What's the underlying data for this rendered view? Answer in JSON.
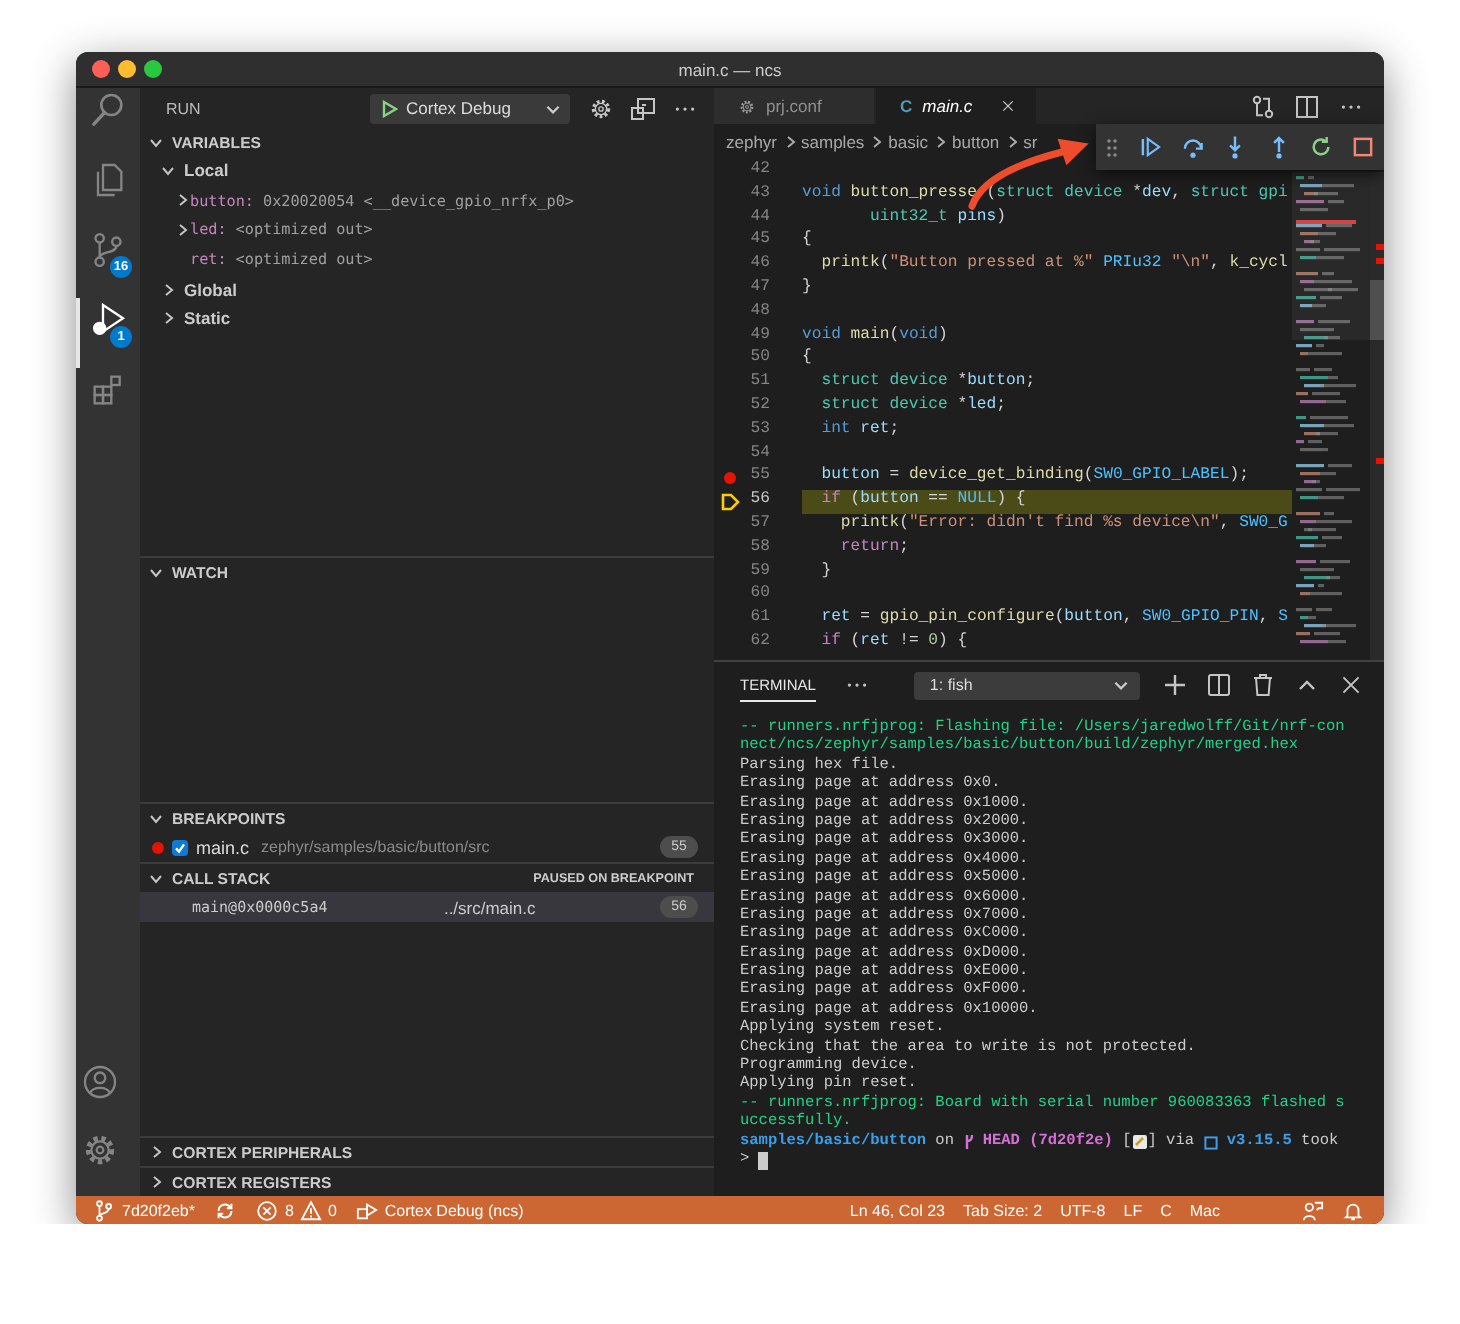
{
  "window": {
    "title": "main.c — ncs"
  },
  "activity_bar": {
    "items": [
      {
        "kind": "search",
        "selected": false
      },
      {
        "kind": "files",
        "selected": false
      },
      {
        "kind": "source-control",
        "badge": "16",
        "selected": false
      },
      {
        "kind": "debug",
        "badge": "1",
        "selected": true
      },
      {
        "kind": "extensions",
        "selected": false
      }
    ],
    "bottom_items": [
      {
        "kind": "account"
      },
      {
        "kind": "settings"
      }
    ]
  },
  "sidebar": {
    "title": "RUN",
    "launch_config": "Cortex Debug",
    "sections": [
      {
        "kind": "variables",
        "title": "VARIABLES",
        "expanded": true,
        "scopes": [
          {
            "name": "Local",
            "expanded": true,
            "children": [
              {
                "name": "button:",
                "value": "0x20020054 <__device_gpio_nrfx_p0>",
                "expanded": false
              },
              {
                "name": "led:",
                "value": "<optimized out>",
                "expanded": false
              },
              {
                "name": "ret:",
                "value": "<optimized out>"
              }
            ]
          },
          {
            "name": "Global",
            "expanded": false
          },
          {
            "name": "Static",
            "expanded": false
          }
        ]
      },
      {
        "kind": "watch",
        "title": "WATCH",
        "expanded": true
      },
      {
        "kind": "breakpoints",
        "title": "BREAKPOINTS",
        "expanded": true,
        "items": [
          {
            "file": "main.c",
            "path": "zephyr/samples/basic/button/src",
            "line": "55",
            "checked": true
          }
        ]
      },
      {
        "kind": "call_stack",
        "title": "CALL STACK",
        "status": "PAUSED ON BREAKPOINT",
        "expanded": true,
        "frames": [
          {
            "name": "main@0x0000c5a4",
            "file": "../src/main.c",
            "line": "56",
            "selected": true
          }
        ]
      },
      {
        "kind": "custom",
        "title": "CORTEX PERIPHERALS",
        "expanded": false
      },
      {
        "kind": "custom",
        "title": "CORTEX REGISTERS",
        "expanded": false
      }
    ]
  },
  "editor": {
    "tabs": [
      {
        "label": "prj.conf",
        "selected": false,
        "preview": false
      },
      {
        "label": "main.c",
        "icon_text": "C",
        "selected": true,
        "preview": true
      }
    ],
    "breadcrumbs": [
      "zephyr",
      "samples",
      "basic",
      "button",
      "sr"
    ],
    "debug_toolbar": [
      {
        "kind": "continue"
      },
      {
        "kind": "step-over"
      },
      {
        "kind": "step-into"
      },
      {
        "kind": "step-out"
      },
      {
        "kind": "restart"
      },
      {
        "kind": "stop"
      }
    ],
    "lines": [
      {
        "number": "42",
        "breakpoint": false,
        "current": false
      },
      {
        "number": "43",
        "breakpoint": false,
        "current": false,
        "tokens": [
          {
            "kind": "kw",
            "text": "void"
          },
          {
            "kind": "fn",
            "text": " button_presse",
            "obscured": true
          },
          {
            "kind": "p",
            "text": "("
          },
          {
            "kind": "type",
            "text": "struct device"
          },
          {
            "kind": "p",
            "text": " *"
          },
          {
            "kind": "var",
            "text": "dev"
          },
          {
            "kind": "p",
            "text": ", "
          },
          {
            "kind": "type",
            "text": "struct gpi"
          }
        ]
      },
      {
        "number": "44",
        "breakpoint": false,
        "current": false,
        "tokens": [
          {
            "kind": "type",
            "text": "       uint32_t"
          },
          {
            "kind": "var",
            "text": " pins"
          },
          {
            "kind": "p",
            "text": ")"
          }
        ]
      },
      {
        "number": "45",
        "breakpoint": false,
        "current": false,
        "tokens": [
          {
            "kind": "p",
            "text": "{"
          }
        ]
      },
      {
        "number": "46",
        "breakpoint": false,
        "current": false,
        "tokens": [
          {
            "kind": "fn",
            "text": "  printk"
          },
          {
            "kind": "p",
            "text": "("
          },
          {
            "kind": "str",
            "text": "\"Button pressed at %\""
          },
          {
            "kind": "mac",
            "text": " PRIu32"
          },
          {
            "kind": "str",
            "text": " \"\\n\""
          },
          {
            "kind": "p",
            "text": ", "
          },
          {
            "kind": "fn",
            "text": "k_cycl"
          }
        ]
      },
      {
        "number": "47",
        "breakpoint": false,
        "current": false,
        "tokens": [
          {
            "kind": "p",
            "text": "}"
          }
        ]
      },
      {
        "number": "48",
        "breakpoint": false,
        "current": false
      },
      {
        "number": "49",
        "breakpoint": false,
        "current": false,
        "tokens": [
          {
            "kind": "kw",
            "text": "void"
          },
          {
            "kind": "fn",
            "text": " main"
          },
          {
            "kind": "p",
            "text": "("
          },
          {
            "kind": "kw",
            "text": "void"
          },
          {
            "kind": "p",
            "text": ")"
          }
        ]
      },
      {
        "number": "50",
        "breakpoint": false,
        "current": false,
        "tokens": [
          {
            "kind": "p",
            "text": "{"
          }
        ]
      },
      {
        "number": "51",
        "breakpoint": false,
        "current": false,
        "tokens": [
          {
            "kind": "type",
            "text": "  struct device"
          },
          {
            "kind": "p",
            "text": " *"
          },
          {
            "kind": "var",
            "text": "button"
          },
          {
            "kind": "p",
            "text": ";"
          }
        ]
      },
      {
        "number": "52",
        "breakpoint": false,
        "current": false,
        "tokens": [
          {
            "kind": "type",
            "text": "  struct device"
          },
          {
            "kind": "p",
            "text": " *"
          },
          {
            "kind": "var",
            "text": "led"
          },
          {
            "kind": "p",
            "text": ";"
          }
        ]
      },
      {
        "number": "53",
        "breakpoint": false,
        "current": false,
        "tokens": [
          {
            "kind": "kw",
            "text": "  int"
          },
          {
            "kind": "var",
            "text": " ret"
          },
          {
            "kind": "p",
            "text": ";"
          }
        ]
      },
      {
        "number": "54",
        "breakpoint": false,
        "current": false
      },
      {
        "number": "55",
        "breakpoint": true,
        "current": false,
        "tokens": [
          {
            "kind": "var",
            "text": "  button"
          },
          {
            "kind": "p",
            "text": " = "
          },
          {
            "kind": "fn",
            "text": "device_get_binding"
          },
          {
            "kind": "p",
            "text": "("
          },
          {
            "kind": "mac",
            "text": "SW0_GPIO_LABEL"
          },
          {
            "kind": "p",
            "text": ");"
          }
        ]
      },
      {
        "number": "56",
        "breakpoint": false,
        "current": true,
        "tokens": [
          {
            "kind": "ctl",
            "text": "  if"
          },
          {
            "kind": "p",
            "text": " ("
          },
          {
            "kind": "var",
            "text": "button"
          },
          {
            "kind": "p",
            "text": " == "
          },
          {
            "kind": "mac",
            "text": "NULL"
          },
          {
            "kind": "p",
            "text": ") {"
          }
        ]
      },
      {
        "number": "57",
        "breakpoint": false,
        "current": false,
        "tokens": [
          {
            "kind": "fn",
            "text": "    printk"
          },
          {
            "kind": "p",
            "text": "("
          },
          {
            "kind": "str",
            "text": "\"Error: didn't find %s device\\n\""
          },
          {
            "kind": "p",
            "text": ", "
          },
          {
            "kind": "mac",
            "text": "SW0_G"
          }
        ]
      },
      {
        "number": "58",
        "breakpoint": false,
        "current": false,
        "tokens": [
          {
            "kind": "ctl",
            "text": "    return"
          },
          {
            "kind": "p",
            "text": ";"
          }
        ]
      },
      {
        "number": "59",
        "breakpoint": false,
        "current": false,
        "tokens": [
          {
            "kind": "p",
            "text": "  }"
          }
        ]
      },
      {
        "number": "60",
        "breakpoint": false,
        "current": false
      },
      {
        "number": "61",
        "breakpoint": false,
        "current": false,
        "tokens": [
          {
            "kind": "var",
            "text": "  ret"
          },
          {
            "kind": "p",
            "text": " = "
          },
          {
            "kind": "fn",
            "text": "gpio_pin_configure"
          },
          {
            "kind": "p",
            "text": "("
          },
          {
            "kind": "var",
            "text": "button"
          },
          {
            "kind": "p",
            "text": ", "
          },
          {
            "kind": "mac",
            "text": "SW0_GPIO_PIN"
          },
          {
            "kind": "p",
            "text": ", "
          },
          {
            "kind": "mac",
            "text": "S"
          }
        ]
      },
      {
        "number": "62",
        "breakpoint": false,
        "current": false,
        "tokens": [
          {
            "kind": "ctl",
            "text": "  if"
          },
          {
            "kind": "p",
            "text": " ("
          },
          {
            "kind": "var",
            "text": "ret"
          },
          {
            "kind": "p",
            "text": " != "
          },
          {
            "kind": "num",
            "text": "0"
          },
          {
            "kind": "p",
            "text": ") {"
          }
        ]
      }
    ]
  },
  "panel": {
    "tabs": [
      {
        "label": "TERMINAL",
        "selected": true
      }
    ],
    "terminal_select": "1: fish",
    "lines": [
      {
        "kind": "info",
        "text": "-- runners.nrfjprog: Flashing file: /Users/jaredwolff/Git/nrf-con"
      },
      {
        "kind": "info",
        "text": "nect/ncs/zephyr/samples/basic/button/build/zephyr/merged.hex"
      },
      {
        "kind": "plain",
        "text": "Parsing hex file."
      },
      {
        "kind": "plain",
        "text": "Erasing page at address 0x0."
      },
      {
        "kind": "plain",
        "text": "Erasing page at address 0x1000."
      },
      {
        "kind": "plain",
        "text": "Erasing page at address 0x2000."
      },
      {
        "kind": "plain",
        "text": "Erasing page at address 0x3000."
      },
      {
        "kind": "plain",
        "text": "Erasing page at address 0x4000."
      },
      {
        "kind": "plain",
        "text": "Erasing page at address 0x5000."
      },
      {
        "kind": "plain",
        "text": "Erasing page at address 0x6000."
      },
      {
        "kind": "plain",
        "text": "Erasing page at address 0x7000."
      },
      {
        "kind": "plain",
        "text": "Erasing page at address 0xC000."
      },
      {
        "kind": "plain",
        "text": "Erasing page at address 0xD000."
      },
      {
        "kind": "plain",
        "text": "Erasing page at address 0xE000."
      },
      {
        "kind": "plain",
        "text": "Erasing page at address 0xF000."
      },
      {
        "kind": "plain",
        "text": "Erasing page at address 0x10000."
      },
      {
        "kind": "plain",
        "text": "Applying system reset."
      },
      {
        "kind": "plain",
        "text": "Checking that the area to write is not protected."
      },
      {
        "kind": "plain",
        "text": "Programming device."
      },
      {
        "kind": "plain",
        "text": "Applying pin reset."
      },
      {
        "kind": "info",
        "text": "-- runners.nrfjprog: Board with serial number 960083363 flashed s"
      },
      {
        "kind": "info",
        "text": "uccessfully."
      },
      {
        "kind": "prompt",
        "segments": [
          {
            "kind": "path",
            "text": "samples/basic/button"
          },
          {
            "kind": "plain",
            "text": " on "
          },
          {
            "kind": "branch-icon"
          },
          {
            "kind": "branch",
            "text": "HEAD (7d20f2e)"
          },
          {
            "kind": "plain",
            "text": " ["
          },
          {
            "kind": "note-icon"
          },
          {
            "kind": "plain",
            "text": "] via "
          },
          {
            "kind": "box-icon"
          },
          {
            "kind": "version",
            "text": "v3.15.5"
          },
          {
            "kind": "plain",
            "text": " took"
          }
        ]
      },
      {
        "kind": "input",
        "text": ">"
      }
    ]
  },
  "status_bar": {
    "left": [
      {
        "kind": "branch",
        "text": "7d20f2eb*"
      },
      {
        "kind": "sync"
      },
      {
        "kind": "problems",
        "errors": "8",
        "warnings": "0"
      },
      {
        "kind": "launch",
        "text": "Cortex Debug (ncs)"
      }
    ],
    "right": [
      {
        "kind": "text",
        "text": "Ln 46, Col 23"
      },
      {
        "kind": "text",
        "text": "Tab Size: 2"
      },
      {
        "kind": "text",
        "text": "UTF-8"
      },
      {
        "kind": "text",
        "text": "LF"
      },
      {
        "kind": "text",
        "text": "C"
      },
      {
        "kind": "text",
        "text": "Mac"
      },
      {
        "kind": "feedback"
      },
      {
        "kind": "bell"
      }
    ]
  }
}
